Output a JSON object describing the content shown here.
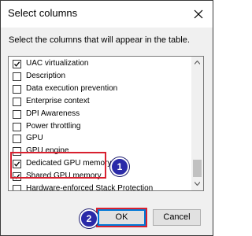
{
  "window": {
    "title": "Select columns",
    "close_icon": "close-icon"
  },
  "instruction": "Select the columns that will appear in the table.",
  "columns": [
    {
      "label": "UAC virtualization",
      "checked": true
    },
    {
      "label": "Description",
      "checked": false
    },
    {
      "label": "Data execution prevention",
      "checked": false
    },
    {
      "label": "Enterprise context",
      "checked": false
    },
    {
      "label": "DPI Awareness",
      "checked": false
    },
    {
      "label": "Power throttling",
      "checked": false
    },
    {
      "label": "GPU",
      "checked": false
    },
    {
      "label": "GPU engine",
      "checked": false
    },
    {
      "label": "Dedicated GPU memory",
      "checked": true
    },
    {
      "label": "Shared GPU memory",
      "checked": true
    },
    {
      "label": "Hardware-enforced Stack Protection",
      "checked": false
    }
  ],
  "annotations": {
    "step1": "1",
    "step2": "2",
    "highlight_color": "#d8202f",
    "badge_color": "#2a2aa8"
  },
  "buttons": {
    "ok_label": "OK",
    "cancel_label": "Cancel"
  }
}
